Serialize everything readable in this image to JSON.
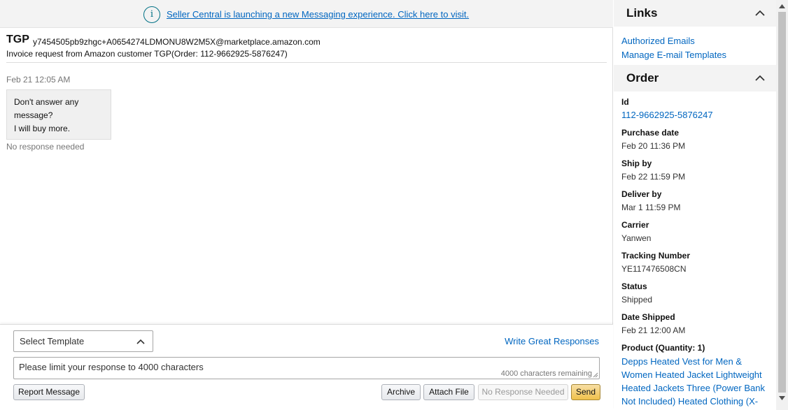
{
  "banner": {
    "icon": "info-icon",
    "icon_glyph": "i",
    "link_text": "Seller Central is launching a new Messaging experience. Click here to visit."
  },
  "header": {
    "buyer_name": "TGP",
    "buyer_email": "y7454505pb9zhgc+A0654274LDMONU8W2M5X@marketplace.amazon.com",
    "subject": "Invoice request from Amazon customer TGP(Order: 112-9662925-5876247)"
  },
  "message": {
    "timestamp": "Feb 21 12:05 AM",
    "lines": [
      "Don't answer any",
      "message?",
      "I will buy more."
    ],
    "status": "No response needed"
  },
  "composer": {
    "template_label": "Select Template",
    "write_link": "Write Great Responses",
    "placeholder": "Please limit your response to 4000 characters",
    "char_count": "4000  characters remaining",
    "buttons": {
      "report": "Report Message",
      "archive": "Archive",
      "attach": "Attach File",
      "no_response": "No Response Needed",
      "send": "Send"
    }
  },
  "side": {
    "links_title": "Links",
    "links": [
      "Authorized Emails",
      "Manage E-mail Templates"
    ],
    "order_title": "Order",
    "fields": [
      {
        "label": "Id",
        "value": "112-9662925-5876247"
      },
      {
        "label": "Purchase date",
        "value": "Feb 20 11:36 PM"
      },
      {
        "label": "Ship by",
        "value": "Feb 22 11:59 PM"
      },
      {
        "label": "Deliver by",
        "value": "Mar 1 11:59 PM"
      },
      {
        "label": "Carrier",
        "value": "Yanwen"
      },
      {
        "label": "Tracking Number",
        "value": "YE117476508CN"
      },
      {
        "label": "Status",
        "value": "Shipped"
      },
      {
        "label": "Date Shipped",
        "value": "Feb 21 12:00 AM"
      }
    ],
    "product_label": "Product (Quantity: 1)",
    "product_text": "Depps Heated Vest for Men & Women Heated Jacket Lightweight Heated Jackets Three (Power Bank Not Included) Heated Clothing (X-"
  },
  "colors": {
    "link": "#0066c0",
    "send_button": "#f0c14b",
    "panel_header": "#f3f3f3"
  }
}
